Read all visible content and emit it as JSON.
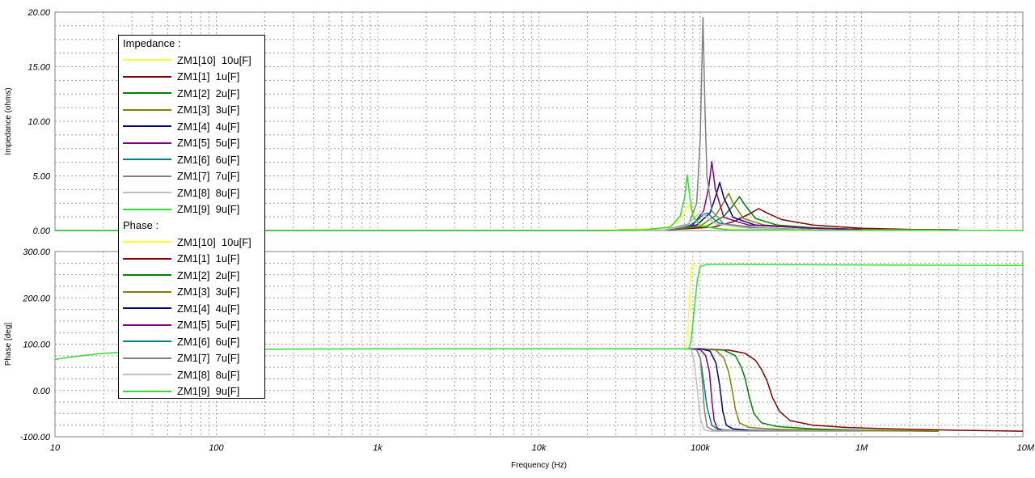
{
  "chart_data": {
    "type": "line",
    "xlabel": "Frequency (Hz)",
    "xscale": "log",
    "xlim": [
      10,
      10000000
    ],
    "xticks": [
      10,
      100,
      1000,
      10000,
      100000,
      1000000,
      10000000
    ],
    "xtick_labels": [
      "10",
      "100",
      "1k",
      "10k",
      "100k",
      "1M",
      "10M"
    ],
    "grid": true,
    "legend_position": "top-left",
    "panels": [
      {
        "name": "impedance",
        "ylabel": "Impedance (ohms)",
        "ylim": [
          0,
          20
        ],
        "yticks": [
          0,
          5,
          10,
          15,
          20
        ],
        "ytick_labels": [
          "0.00",
          "5.00",
          "10.00",
          "15.00",
          "20.00"
        ],
        "legend_title": "Impedance :",
        "series": [
          {
            "name": "ZM1[10]  10u[F]",
            "color": "#ffff33",
            "x": [
              10,
              20000,
              60000,
              75000,
              80000,
              85000,
              90000,
              100000,
              120000,
              200000,
              500000
            ],
            "y": [
              0,
              0,
              0.2,
              0.9,
              1.8,
              2.4,
              1.5,
              0.6,
              0.2,
              0.05,
              0
            ]
          },
          {
            "name": "ZM1[1]  1u[F]",
            "color": "#800000",
            "x": [
              10,
              20000,
              60000,
              120000,
              160000,
              200000,
              230000,
              260000,
              320000,
              500000,
              1000000,
              2000000,
              4000000
            ],
            "y": [
              0,
              0,
              0.05,
              0.3,
              0.8,
              1.5,
              2.0,
              1.6,
              1.0,
              0.5,
              0.2,
              0.1,
              0.05
            ]
          },
          {
            "name": "ZM1[2]  2u[F]",
            "color": "#008000",
            "x": [
              10,
              20000,
              60000,
              110000,
              140000,
              160000,
              175000,
              190000,
              220000,
              300000,
              500000,
              1000000,
              3000000
            ],
            "y": [
              0,
              0,
              0.05,
              0.4,
              1.3,
              2.3,
              3.1,
              2.3,
              1.1,
              0.5,
              0.25,
              0.1,
              0.05
            ]
          },
          {
            "name": "ZM1[3]  3u[F]",
            "color": "#808000",
            "x": [
              10,
              20000,
              60000,
              100000,
              125000,
              140000,
              150000,
              160000,
              185000,
              250000,
              500000,
              1000000,
              3000000
            ],
            "y": [
              0,
              0,
              0.05,
              0.4,
              1.4,
              2.6,
              3.4,
              2.5,
              1.1,
              0.5,
              0.2,
              0.1,
              0.05
            ]
          },
          {
            "name": "ZM1[4]  4u[F]",
            "color": "#000080",
            "x": [
              10,
              20000,
              60000,
              95000,
              115000,
              125000,
              132000,
              140000,
              160000,
              220000,
              500000,
              1000000
            ],
            "y": [
              0,
              0,
              0.05,
              0.5,
              1.6,
              3.2,
              4.4,
              3.0,
              1.2,
              0.5,
              0.2,
              0.1
            ]
          },
          {
            "name": "ZM1[5]  5u[F]",
            "color": "#800080",
            "x": [
              10,
              20000,
              60000,
              90000,
              105000,
              113000,
              118000,
              124000,
              140000,
              200000,
              500000,
              1000000
            ],
            "y": [
              0,
              0,
              0.05,
              0.5,
              1.8,
              4.0,
              6.3,
              3.8,
              1.2,
              0.5,
              0.2,
              0.1
            ]
          },
          {
            "name": "ZM1[6]  6u[F]",
            "color": "#008080",
            "x": [
              10,
              20000,
              60000,
              85000,
              97000,
              105000,
              112000,
              118000,
              130000,
              180000,
              400000
            ],
            "y": [
              0,
              0,
              0.05,
              0.4,
              1.0,
              1.5,
              1.6,
              1.2,
              0.7,
              0.3,
              0.1
            ]
          },
          {
            "name": "ZM1[7]  7u[F]",
            "color": "#808080",
            "x": [
              10,
              20000,
              60000,
              85000,
              95000,
              100000,
              104000,
              107000,
              110000,
              118000,
              140000,
              250000,
              500000
            ],
            "y": [
              0,
              0,
              0.05,
              0.6,
              2.5,
              8.5,
              19.5,
              11.0,
              5.0,
              1.8,
              0.6,
              0.2,
              0.1
            ]
          },
          {
            "name": "ZM1[8]  8u[F]",
            "color": "#c0c0c0",
            "x": [
              10,
              20000,
              60000,
              80000,
              90000,
              97000,
              103000,
              110000,
              125000,
              200000,
              500000
            ],
            "y": [
              0,
              0,
              0.05,
              0.4,
              1.0,
              1.5,
              1.6,
              1.2,
              0.6,
              0.2,
              0.05
            ]
          },
          {
            "name": "ZM1[9]  9u[F]",
            "color": "#33dd33",
            "x": [
              10,
              40000,
              65000,
              75000,
              80000,
              83000,
              86000,
              90000,
              100000,
              150000,
              10000000
            ],
            "y": [
              0,
              0,
              0.3,
              1.3,
              3.0,
              5.1,
              3.2,
              1.3,
              0.4,
              0.05,
              0
            ]
          }
        ]
      },
      {
        "name": "phase",
        "ylabel": "Phase [deg]",
        "ylim": [
          -100,
          300
        ],
        "yticks": [
          -100,
          0,
          100,
          200,
          300
        ],
        "ytick_labels": [
          "-100.00",
          "0.00",
          "100.00",
          "200.00",
          "300.00"
        ],
        "legend_title": "Phase :",
        "series": [
          {
            "name": "ZM1[10]  10u[F]",
            "color": "#ffff33",
            "x": [
              40000,
              80000,
              82000,
              84000,
              86000,
              88000,
              90000,
              95000
            ],
            "y": [
              90,
              90,
              93,
              130,
              210,
              265,
              270,
              270
            ]
          },
          {
            "name": "ZM1[1]  1u[F]",
            "color": "#800000",
            "x": [
              80000,
              100000,
              150000,
              190000,
              220000,
              240000,
              260000,
              280000,
              310000,
              360000,
              500000,
              800000,
              1500000,
              4000000,
              10000000
            ],
            "y": [
              90,
              90,
              87,
              80,
              65,
              45,
              20,
              -15,
              -45,
              -65,
              -75,
              -80,
              -83,
              -86,
              -88
            ]
          },
          {
            "name": "ZM1[2]  2u[F]",
            "color": "#008000",
            "x": [
              80000,
              100000,
              140000,
              165000,
              180000,
              190000,
              200000,
              215000,
              240000,
              300000,
              500000,
              1000000,
              3000000
            ],
            "y": [
              90,
              90,
              87,
              75,
              50,
              25,
              -10,
              -50,
              -70,
              -78,
              -83,
              -86,
              -88
            ]
          },
          {
            "name": "ZM1[3]  3u[F]",
            "color": "#808000",
            "x": [
              80000,
              100000,
              125000,
              140000,
              150000,
              158000,
              165000,
              175000,
              200000,
              300000,
              1000000,
              3000000
            ],
            "y": [
              90,
              90,
              87,
              70,
              40,
              0,
              -40,
              -70,
              -80,
              -84,
              -87,
              -88
            ]
          },
          {
            "name": "ZM1[4]  4u[F]",
            "color": "#000080",
            "x": [
              80000,
              100000,
              115000,
              125000,
              132000,
              138000,
              145000,
              160000,
              200000,
              500000,
              1000000
            ],
            "y": [
              90,
              90,
              85,
              60,
              10,
              -45,
              -75,
              -83,
              -86,
              -88,
              -88
            ]
          },
          {
            "name": "ZM1[5]  5u[F]",
            "color": "#800080",
            "x": [
              80000,
              100000,
              108000,
              114000,
              118000,
              122000,
              128000,
              140000,
              200000,
              500000
            ],
            "y": [
              90,
              88,
              75,
              40,
              -20,
              -65,
              -82,
              -86,
              -88,
              -88
            ]
          },
          {
            "name": "ZM1[6]  6u[F]",
            "color": "#008080",
            "x": [
              80000,
              95000,
              100000,
              105000,
              110000,
              118000,
              130000,
              200000,
              500000
            ],
            "y": [
              90,
              88,
              70,
              20,
              -35,
              -75,
              -85,
              -88,
              -88
            ]
          },
          {
            "name": "ZM1[7]  7u[F]",
            "color": "#808080",
            "x": [
              80000,
              95000,
              100000,
              103000,
              106000,
              110000,
              120000,
              200000,
              500000
            ],
            "y": [
              90,
              88,
              70,
              20,
              -40,
              -78,
              -86,
              -88,
              -88
            ]
          },
          {
            "name": "ZM1[8]  8u[F]",
            "color": "#c0c0c0",
            "x": [
              80000,
              88000,
              92000,
              96000,
              100000,
              106000,
              115000,
              200000,
              1000000
            ],
            "y": [
              90,
              88,
              60,
              0,
              -60,
              -85,
              -88,
              -88,
              -88
            ]
          },
          {
            "name": "ZM1[9]  9u[F]",
            "color": "#33dd33",
            "x": [
              10,
              13,
              20,
              30,
              50,
              100,
              200,
              400,
              1000,
              10000,
              50000,
              85000,
              88000,
              92000,
              96000,
              100000,
              110000,
              200000,
              1000000,
              10000000
            ],
            "y": [
              67,
              73,
              80,
              84,
              87,
              88.5,
              89,
              89.5,
              90,
              90,
              90,
              90,
              110,
              180,
              240,
              268,
              272,
              272,
              271,
              270
            ]
          }
        ]
      }
    ]
  }
}
